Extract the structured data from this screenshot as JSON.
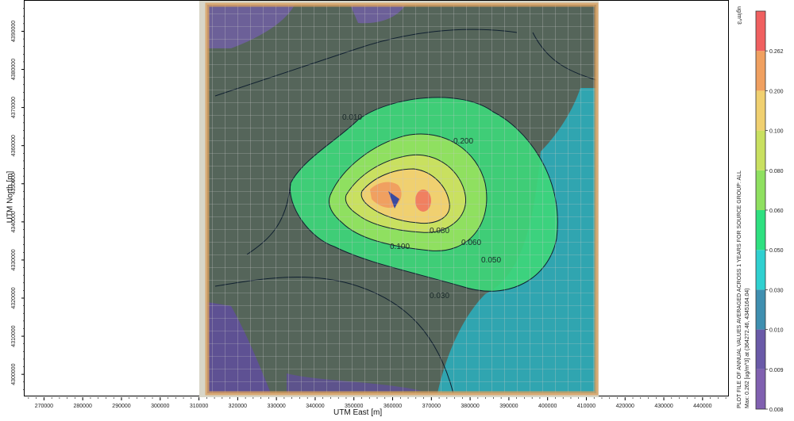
{
  "chart_data": {
    "type": "heatmap",
    "title": "PLOT FILE OF ANNUAL VALUES AVERAGED ACROSS 1 YEARS FOR SOURCE GROUP: ALL",
    "subtitle": "Max: 0.262 [ug/m^3] at (364272.46, 4345164.04)",
    "xlabel": "UTM East [m]",
    "ylabel": "UTM North [m]",
    "xlim": [
      265000,
      447000
    ],
    "ylim": [
      4294000,
      4398000
    ],
    "x_ticks": [
      "270000",
      "280000",
      "290000",
      "300000",
      "310000",
      "320000",
      "330000",
      "340000",
      "350000",
      "360000",
      "370000",
      "380000",
      "390000",
      "400000",
      "410000",
      "420000",
      "430000",
      "440000"
    ],
    "y_ticks": [
      "4300000",
      "4310000",
      "4320000",
      "4330000",
      "4340000",
      "4350000",
      "4360000",
      "4370000",
      "4380000",
      "4390000"
    ],
    "colorbar": {
      "unit": "ug/m^3",
      "levels": [
        "0.008",
        "0.009",
        "0.010",
        "0.030",
        "0.050",
        "0.060",
        "0.080",
        "0.100",
        "0.200",
        "0.262"
      ],
      "colors": [
        "#8060b0",
        "#6a5aa8",
        "#3f8fb0",
        "#2fd0d0",
        "#2ee080",
        "#8fe060",
        "#c9e060",
        "#f0d070",
        "#f0a060",
        "#f06060"
      ]
    },
    "contour_labels": [
      "0.010",
      "0.030",
      "0.050",
      "0.060",
      "0.080",
      "0.100",
      "0.200"
    ],
    "max_point": {
      "x": 364272.46,
      "y": 4345164.04,
      "value": 0.262
    },
    "grid": true
  }
}
